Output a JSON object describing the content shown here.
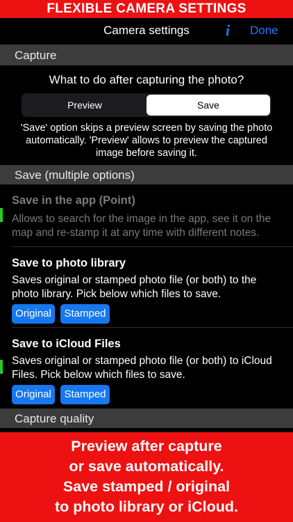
{
  "banner_top": "FLEXIBLE CAMERA SETTINGS",
  "nav": {
    "title": "Camera settings",
    "info_icon": "i",
    "done_label": "Done"
  },
  "capture": {
    "header": "Capture",
    "question": "What to do after capturing the photo?",
    "segments": [
      "Preview",
      "Save"
    ],
    "selected": "Save",
    "description": "'Save' option skips a preview screen by saving the photo automatically. 'Preview' allows to preview the captured image before saving it."
  },
  "save": {
    "header": "Save (multiple options)",
    "items": [
      {
        "title": "Save in the app (Point)",
        "description": "Allows to search for the image in the app, see it on the map and re-stamp it at any time with different notes.",
        "enabled": false,
        "indicator_color": "#22cc22"
      },
      {
        "title": "Save to photo library",
        "description": "Saves original or stamped photo file (or both) to the photo library. Pick below which files to save.",
        "enabled": true,
        "buttons": [
          "Original",
          "Stamped"
        ]
      },
      {
        "title": "Save to iCloud Files",
        "description": "Saves original or stamped photo file (or both) to iCloud Files. Pick below which files to save.",
        "enabled": true,
        "indicator_color": "#22cc22",
        "buttons": [
          "Original",
          "Stamped"
        ]
      }
    ]
  },
  "quality": {
    "header": "Capture quality"
  },
  "banner_bottom": [
    "Preview after capture",
    "or save automatically.",
    "Save stamped / original",
    "to photo library or iCloud."
  ],
  "colors": {
    "banner": "#ee1111",
    "accent": "#1d7cf2",
    "pill": "#1677ee",
    "indicator": "#22cc22"
  }
}
